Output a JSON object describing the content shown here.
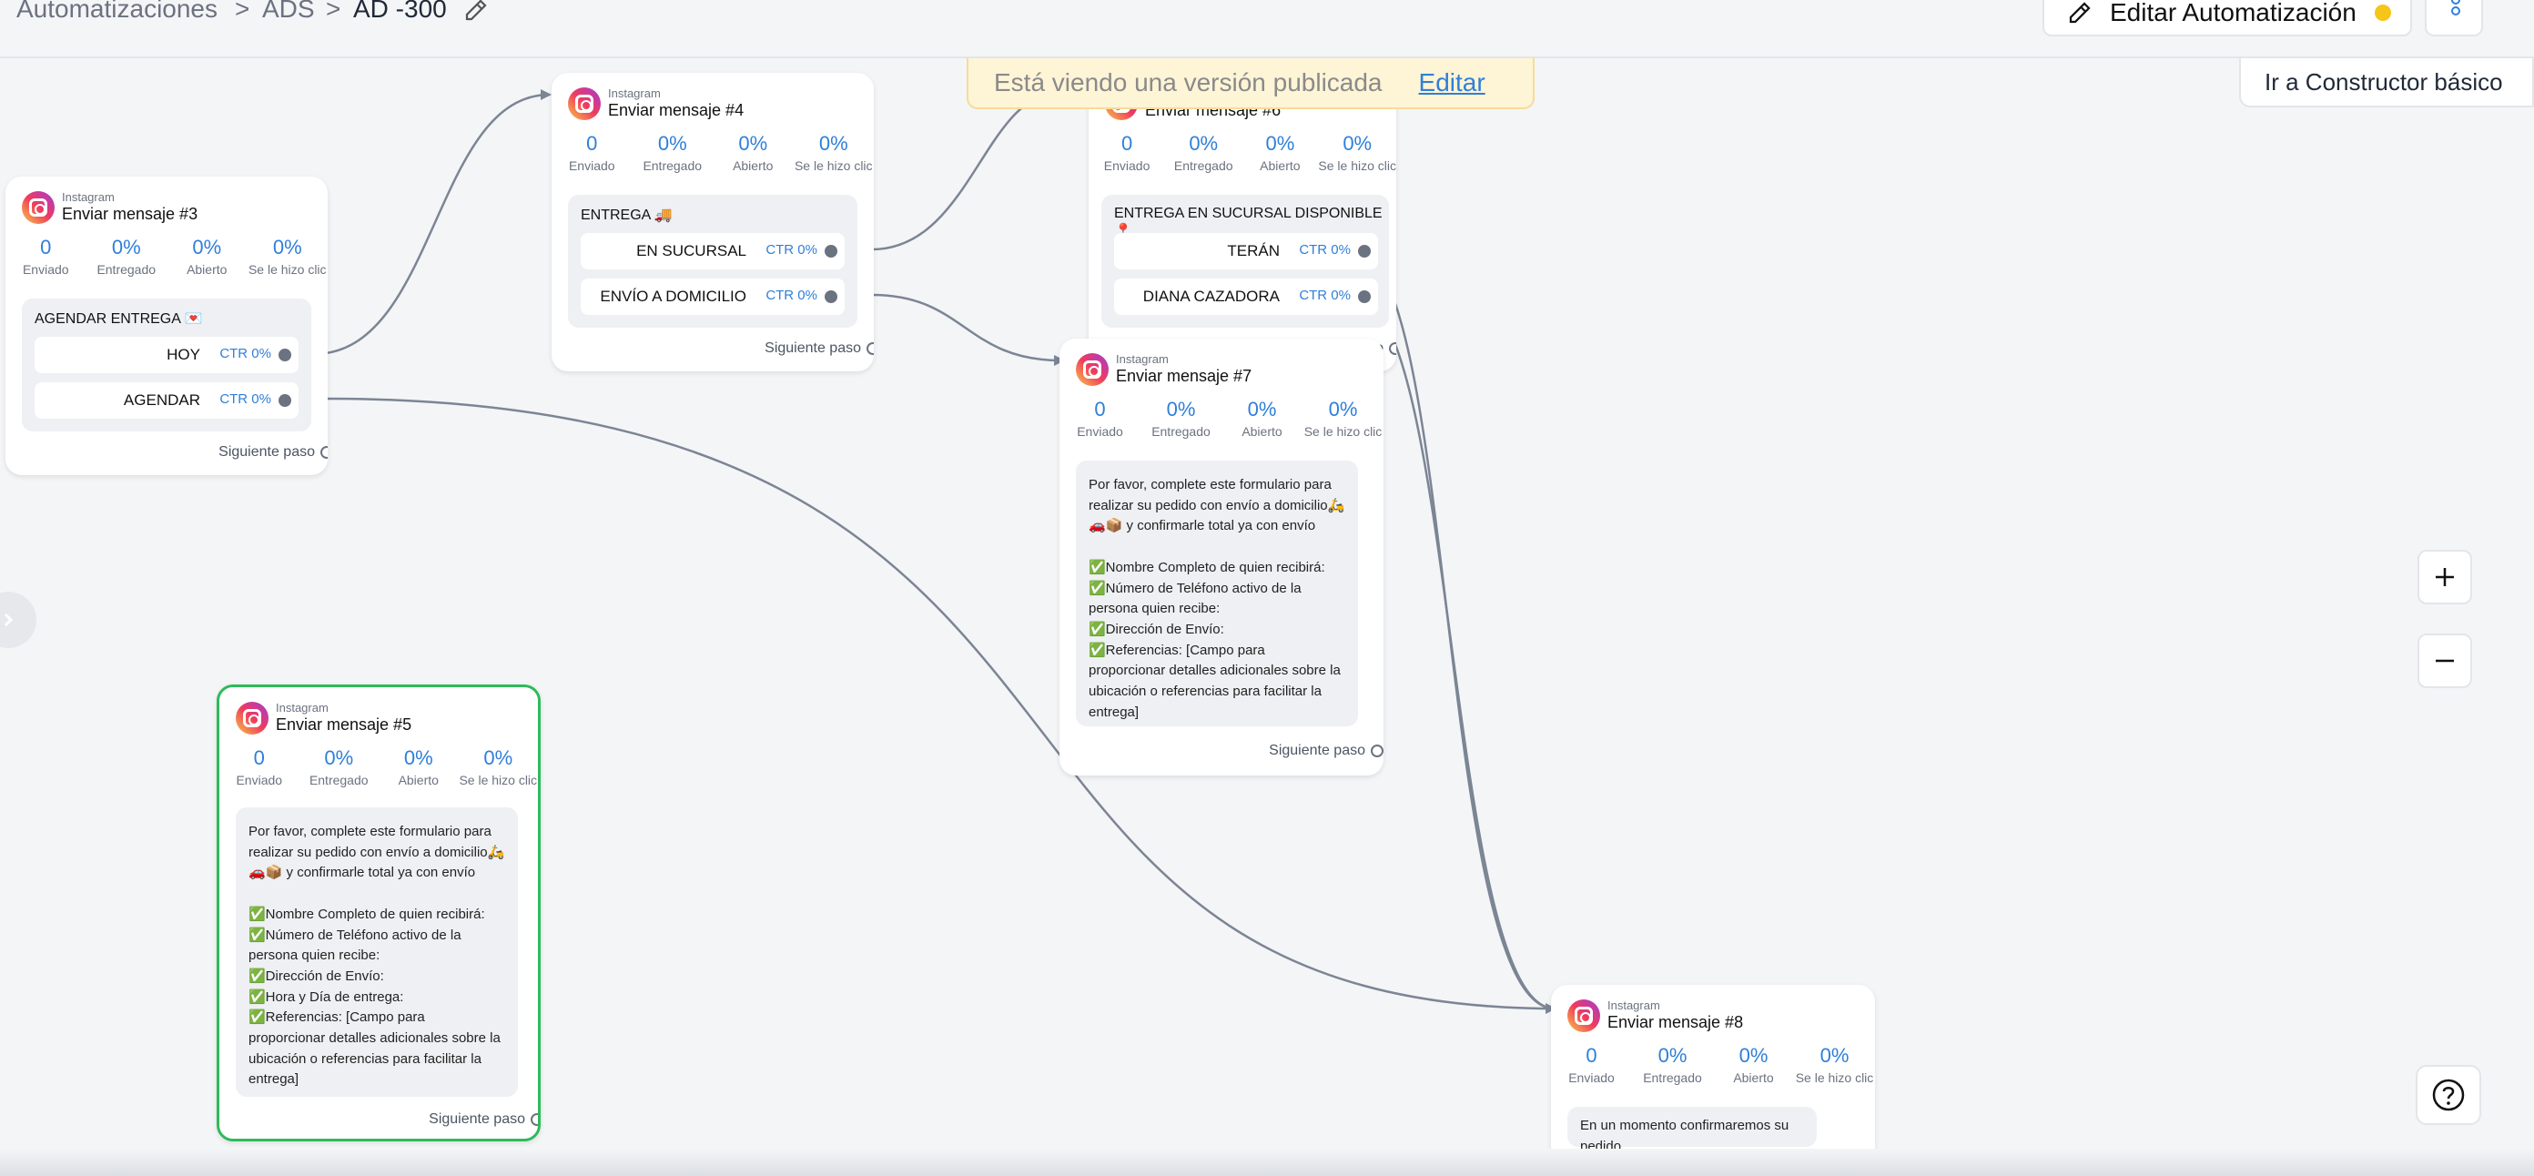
{
  "breadcrumb": {
    "root": "Automatizaciones",
    "group": "ADS",
    "current": "AD -300",
    "sep": ">"
  },
  "header": {
    "edit_automation": "Editar Automatización",
    "status_color": "#f5c518"
  },
  "banner": {
    "text": "Está viendo una versión publicada",
    "link": "Editar"
  },
  "basic_builder": "Ir a Constructor básico",
  "stat_labels": [
    "Enviado",
    "Entregado",
    "Abierto",
    "Se le hizo clic"
  ],
  "next_label": "Siguiente paso",
  "platform": "Instagram",
  "nodes": {
    "m3": {
      "title": "Enviar mensaje #3",
      "stats": [
        "0",
        "0%",
        "0%",
        "0%"
      ],
      "box_title": "AGENDAR ENTREGA 💌",
      "buttons": [
        {
          "label": "HOY",
          "ctr": "CTR 0%"
        },
        {
          "label": "AGENDAR",
          "ctr": "CTR 0%"
        }
      ]
    },
    "m4": {
      "title": "Enviar mensaje #4",
      "stats": [
        "0",
        "0%",
        "0%",
        "0%"
      ],
      "box_title": "ENTREGA 🚚",
      "buttons": [
        {
          "label": "EN SUCURSAL",
          "ctr": "CTR 0%"
        },
        {
          "label": "ENVÍO A DOMICILIO",
          "ctr": "CTR 0%"
        }
      ]
    },
    "m6": {
      "title": "Enviar mensaje #6",
      "stats": [
        "0",
        "0%",
        "0%",
        "0%"
      ],
      "box_title": "ENTREGA EN SUCURSAL DISPONIBLE 📍",
      "buttons": [
        {
          "label": "TERÁN",
          "ctr": "CTR 0%"
        },
        {
          "label": "DIANA CAZADORA",
          "ctr": "CTR 0%"
        }
      ]
    },
    "m7": {
      "title": "Enviar mensaje #7",
      "stats": [
        "0",
        "0%",
        "0%",
        "0%"
      ],
      "text": "Por favor, complete este formulario para realizar su pedido con envío a domicilio🛵🚗📦 y confirmarle total ya con envío\n\n✅Nombre Completo de quien recibirá:\n✅Número de Teléfono activo de la persona quien recibe:\n✅Dirección de Envío:\n✅Referencias: [Campo para proporcionar detalles adicionales sobre la ubicación o referencias para facilitar la entrega]"
    },
    "m5": {
      "title": "Enviar mensaje #5",
      "stats": [
        "0",
        "0%",
        "0%",
        "0%"
      ],
      "text": "Por favor, complete este formulario para realizar su pedido con envío a domicilio🛵🚗📦 y confirmarle total ya con envío\n\n✅Nombre Completo de quien recibirá:\n✅Número de Teléfono activo de la persona quien recibe:\n✅Dirección de Envío:\n✅Hora y Día de entrega:\n✅Referencias: [Campo para proporcionar detalles adicionales sobre la ubicación o referencias para facilitar la entrega]"
    },
    "m8": {
      "title": "Enviar mensaje #8",
      "stats": [
        "0",
        "0%",
        "0%",
        "0%"
      ],
      "text": "En un momento confirmaremos su pedido"
    }
  },
  "zoom": {
    "in": "+",
    "out": "−"
  },
  "help": "?",
  "colors": {
    "accent": "#2f7fd9",
    "selected_border": "#2dbb5a",
    "edge": "#7b8594",
    "banner_bg": "#fef4d6"
  },
  "icons": [
    "pencil-icon",
    "instagram-icon",
    "plus-icon",
    "minus-icon",
    "question-icon",
    "chevron-right-icon",
    "more-vertical-icon"
  ]
}
